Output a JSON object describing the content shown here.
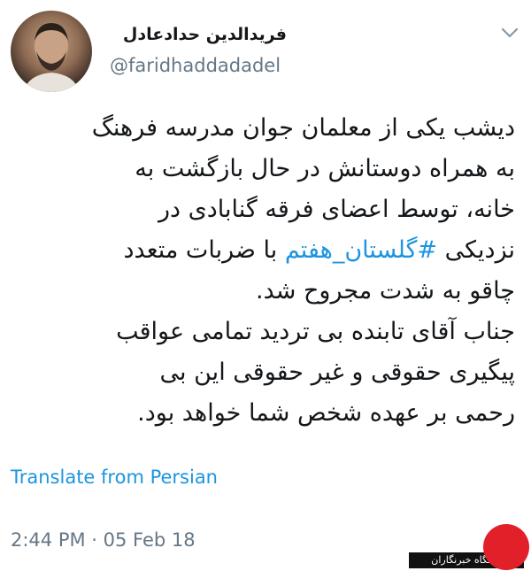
{
  "author": {
    "display_name": "فریدالدین حدادعادل",
    "handle": "@faridhaddadadel"
  },
  "tweet": {
    "lines": [
      "دیشب یکی از معلمان جوان مدرسه فرهنگ",
      "به همراه دوستانش در حال بازگشت به",
      "خانه، توسط اعضای فرقه گنابادی در",
      "چاقو به شدت مجروح شد.",
      "جناب آقای تابنده بی تردید تمامی عواقب",
      "پیگیری حقوقی و غیر حقوقی این بی",
      "رحمی بر عهده شخص شما خواهد بود."
    ],
    "line4_before": "نزدیکی ",
    "hashtag": "#گلستان_هفتم",
    "line4_after": " با ضربات متعدد"
  },
  "translate_label": "Translate from Persian",
  "timestamp": "2:44 PM · 05 Feb 18",
  "watermark": {
    "text": "باشگاه خبرنگاران"
  },
  "colors": {
    "link": "#1b95e0",
    "secondary": "#657786",
    "text": "#14171a",
    "watermark_red": "#e2202a"
  },
  "icons": {
    "menu": "chevron-down-icon"
  }
}
